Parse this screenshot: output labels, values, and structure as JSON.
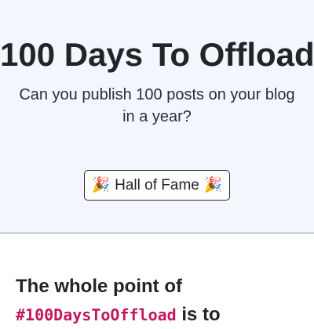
{
  "hero": {
    "title": "100 Days To Offload",
    "subtitle": "Can you publish 100 posts on your blog in a year?",
    "button": {
      "label": "Hall of Fame",
      "icon": "party-popper-icon",
      "icon_glyph": "🎉"
    }
  },
  "intro": {
    "lead": "The whole point of",
    "hashtag": "#100DaysToOffload",
    "trail": "is to",
    "hashtag_color": "#c2185b"
  }
}
